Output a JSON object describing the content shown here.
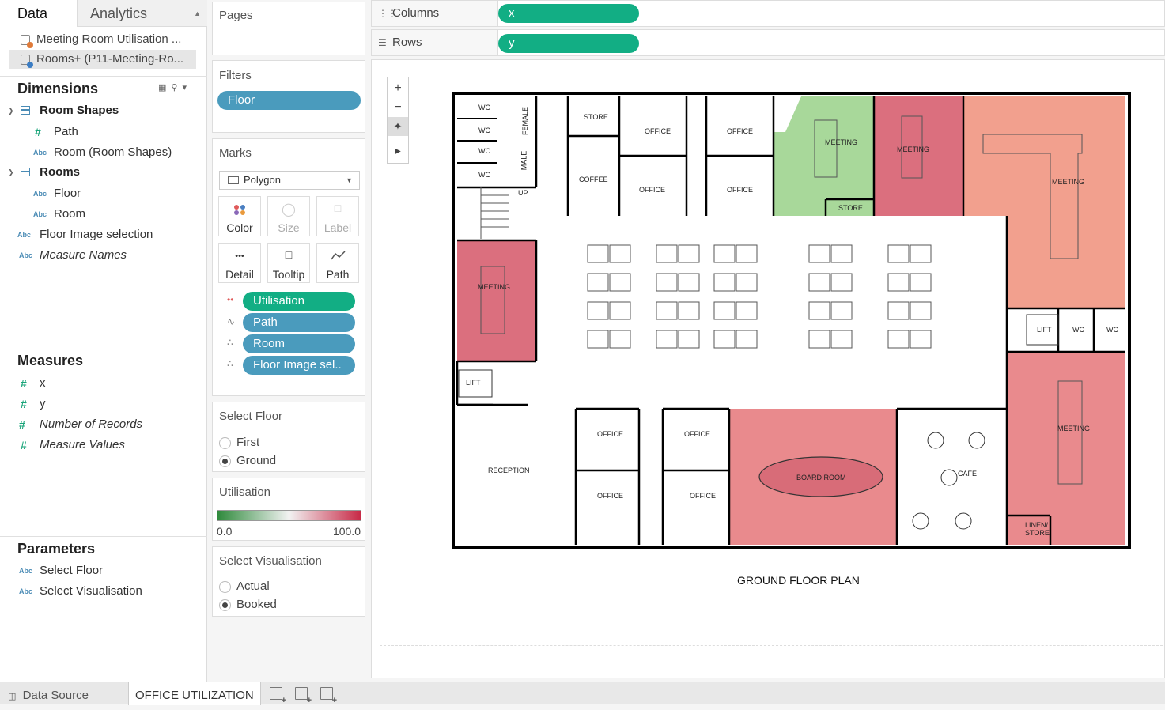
{
  "left_pane": {
    "tab_data": "Data",
    "tab_analytics": "Analytics",
    "data_sources": [
      {
        "label": "Meeting Room Utilisation ..."
      },
      {
        "label": "Rooms+ (P11-Meeting-Ro..."
      }
    ],
    "dimensions_header": "Dimensions",
    "dimensions": [
      {
        "label": "Room Shapes",
        "type": "table"
      },
      {
        "label": "Path",
        "type": "number"
      },
      {
        "label": "Room (Room Shapes)",
        "type": "string"
      },
      {
        "label": "Rooms",
        "type": "table"
      },
      {
        "label": "Floor",
        "type": "string"
      },
      {
        "label": "Room",
        "type": "string"
      },
      {
        "label": "Floor Image selection",
        "type": "string"
      },
      {
        "label": "Measure Names",
        "type": "string"
      }
    ],
    "measures_header": "Measures",
    "measures": [
      {
        "label": "x"
      },
      {
        "label": "y"
      },
      {
        "label": "Number of Records"
      },
      {
        "label": "Measure Values"
      }
    ],
    "parameters_header": "Parameters",
    "parameters": [
      {
        "label": "Select Floor"
      },
      {
        "label": "Select Visualisation"
      }
    ],
    "type_icon_abc": "Abc",
    "type_icon_hash": "#"
  },
  "shelves": {
    "pages_title": "Pages",
    "filters_title": "Filters",
    "filter_pill": "Floor",
    "marks_title": "Marks",
    "mark_type": "Polygon",
    "mark_buttons": [
      "Color",
      "Size",
      "Label",
      "Detail",
      "Tooltip",
      "Path"
    ],
    "mark_pills": [
      "Utilisation",
      "Path",
      "Room",
      "Floor Image sel.."
    ],
    "columns_label": "Columns",
    "columns_pill": "x",
    "rows_label": "Rows",
    "rows_pill": "y"
  },
  "select_floor": {
    "title": "Select Floor",
    "options": [
      "First",
      "Ground"
    ],
    "selected": "Ground"
  },
  "utilisation_legend": {
    "title": "Utilisation",
    "min_label": "0.0",
    "max_label": "100.0",
    "color_low": "#2f8a3c",
    "color_mid": "#f2f2f2",
    "color_high": "#c82a47"
  },
  "select_visualisation": {
    "title": "Select Visualisation",
    "options": [
      "Actual",
      "Booked"
    ],
    "selected": "Booked"
  },
  "floor_plan": {
    "title": "GROUND FLOOR PLAN",
    "room_labels": {
      "wc1": "WC",
      "wc2": "WC",
      "wc3": "WC",
      "wc4": "WC",
      "female": "FEMALE",
      "male": "MALE",
      "up": "UP",
      "store1": "STORE",
      "coffee": "COFFEE",
      "office1": "OFFICE",
      "office2": "OFFICE",
      "office3": "OFFICE",
      "office4": "OFFICE",
      "meeting_green": "MEETING",
      "store2": "STORE",
      "meeting_red_top": "MEETING",
      "meeting_salmon": "MEETING",
      "meeting_left": "MEETING",
      "lift1": "LIFT",
      "lift2": "LIFT",
      "wc5": "WC",
      "wc6": "WC",
      "reception": "RECEPTION",
      "office5": "OFFICE",
      "office6": "OFFICE",
      "office7": "OFFICE",
      "office8": "OFFICE",
      "board_room": "BOARD ROOM",
      "cafe": "CAFE",
      "meeting_right": "MEETING",
      "linen_store_1": "LINEN/",
      "linen_store_2": "STORE"
    },
    "room_colors": {
      "green": "#a8d89a",
      "red": "#db6f7e",
      "salmon": "#f2a08e",
      "pink": "#e98a8d"
    }
  },
  "bottom_tabs": {
    "data_source": "Data Source",
    "sheet": "OFFICE UTILIZATION"
  }
}
